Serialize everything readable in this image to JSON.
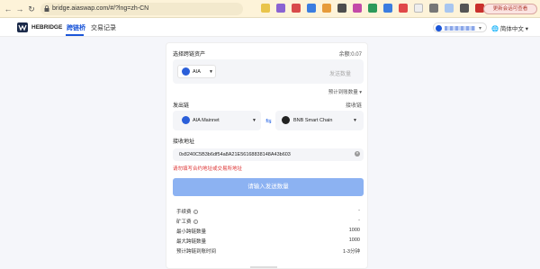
{
  "browser": {
    "url": "bridge.aiaswap.com/#/?lng=zh-CN",
    "ext_button": "更新会话可查看"
  },
  "header": {
    "logo_text": "HEBRIDGE",
    "tabs": [
      {
        "label": "跨链桥",
        "active": true
      },
      {
        "label": "交易记录",
        "active": false
      }
    ],
    "language": "简体中文"
  },
  "form": {
    "asset_label": "选择跨链资产",
    "balance_label": "余额:0.07",
    "asset": {
      "symbol": "AIA",
      "icon": "aia-coin-icon"
    },
    "amount_placeholder": "发送数量",
    "fee_link": "预计到账数量 ▾",
    "from_label": "发出链",
    "to_label": "接收链",
    "from_chain": {
      "name": "AIA Mainnet",
      "icon": "aia-coin-icon"
    },
    "to_chain": {
      "name": "BNB Smart Chain",
      "icon": "bnb-coin-icon"
    },
    "receive_label": "接收地址",
    "receive_address": "0x8240C5B3b6df54a8A21E56168838148A43b603",
    "warning": "请勿填写合约地址或交易所地址",
    "submit_label": "请输入发送数量"
  },
  "details": [
    {
      "label": "手续费",
      "info": true,
      "value": "-"
    },
    {
      "label": "矿工费",
      "info": true,
      "value": "-"
    },
    {
      "label": "最小跨链数量",
      "info": false,
      "value": "1000"
    },
    {
      "label": "最大跨链数量",
      "info": false,
      "value": "1000"
    },
    {
      "label": "预计跨链到账时间",
      "info": false,
      "value": "1-3分钟"
    }
  ],
  "colors": {
    "accent": "#1a55d8",
    "warning": "#dd3333",
    "submit_disabled": "#8cb2f2"
  }
}
